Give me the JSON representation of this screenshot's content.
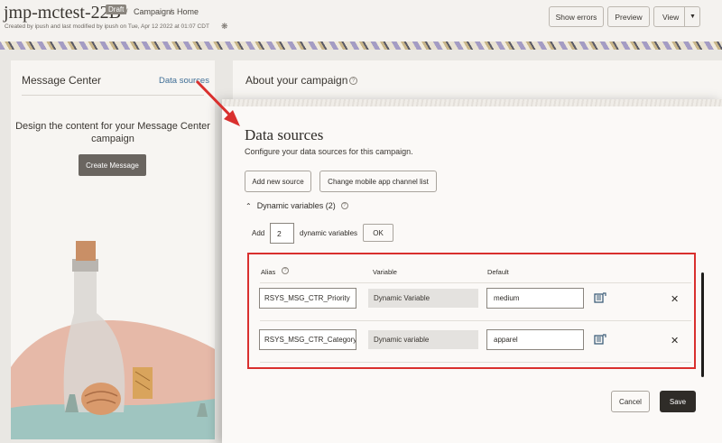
{
  "header": {
    "title": "jmp-mctest-22B",
    "status_badge": "Draft",
    "breadcrumb": [
      "Campaigns",
      "Home"
    ],
    "meta": "Created by ipush and last modified by ipush on Tue, Apr 12 2022 at 01:07 CDT",
    "buttons": {
      "show_errors": "Show errors",
      "preview": "Preview",
      "view": "View"
    }
  },
  "left_panel": {
    "title": "Message Center",
    "data_sources_link": "Data sources",
    "description": "Design the content for your Message Center campaign",
    "create_button": "Create Message"
  },
  "back_panel": {
    "title": "About your campaign"
  },
  "dialog": {
    "title": "Data sources",
    "subtitle": "Configure your data sources for this campaign.",
    "add_source_button": "Add new source",
    "change_list_button": "Change mobile app channel list",
    "section_label": "Dynamic variables (2)",
    "add_label": "Add",
    "add_count": "2",
    "dynamic_variables_label": "dynamic variables",
    "ok_button": "OK",
    "columns": {
      "alias": "Alias",
      "variable": "Variable",
      "default": "Default"
    },
    "rows": [
      {
        "alias": "RSYS_MSG_CTR_Priority",
        "variable": "Dynamic Variable",
        "default": "medium"
      },
      {
        "alias": "RSYS_MSG_CTR_Category",
        "variable": "Dynamic variable",
        "default": "apparel"
      }
    ],
    "cancel_button": "Cancel",
    "save_button": "Save"
  },
  "colors": {
    "highlight": "#d9302e",
    "primary_button": "#2f2c28",
    "link": "#3f6e96"
  }
}
